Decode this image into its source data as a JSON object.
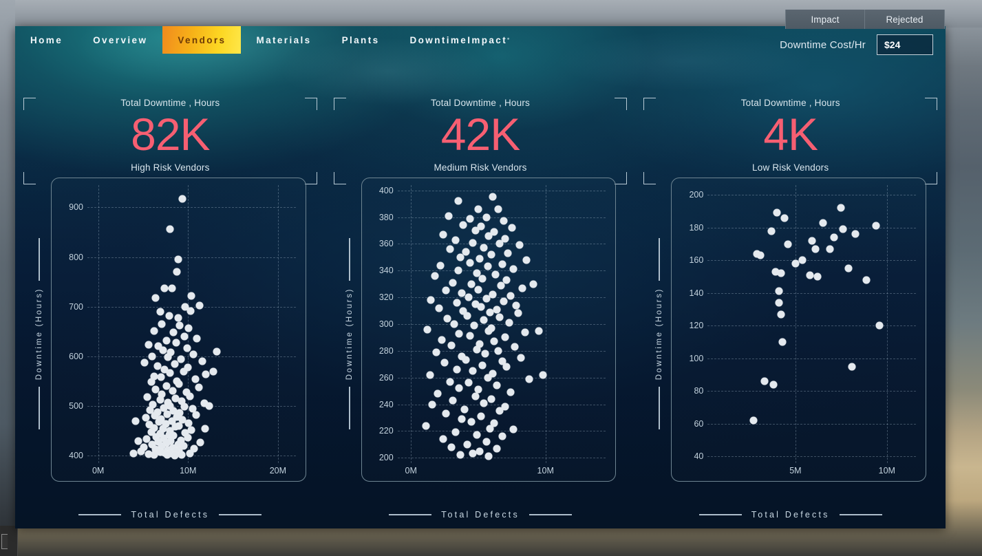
{
  "window": {
    "tabs": [
      {
        "label": "Impact"
      },
      {
        "label": "Rejected"
      }
    ]
  },
  "nav": {
    "items": [
      {
        "label": "Home",
        "active": false
      },
      {
        "label": "Overview",
        "active": false
      },
      {
        "label": "Vendors",
        "active": true
      },
      {
        "label": "Materials",
        "active": false
      },
      {
        "label": "Plants",
        "active": false
      },
      {
        "label": "DowntimeImpact",
        "active": false
      }
    ]
  },
  "cost": {
    "label": "Downtime Cost/Hr",
    "value": "$24",
    "placeholder": "$24"
  },
  "kpis": [
    {
      "top": "Total Downtime , Hours",
      "value": "82K",
      "bottom": "High Risk Vendors"
    },
    {
      "top": "Total Downtime , Hours",
      "value": "42K",
      "bottom": "Medium Risk Vendors"
    },
    {
      "top": "Total Downtime , Hours",
      "value": "4K",
      "bottom": "Low Risk Vendors"
    }
  ],
  "colors": {
    "accent_kpi": "#f65f72",
    "nav_active_start": "#f08a1e",
    "nav_active_end": "#ffe74a",
    "dot": "#e4e9ee",
    "panel_border": "#6e8592"
  },
  "chart_data": [
    {
      "type": "scatter",
      "title": "High Risk Vendors",
      "xlabel": "Total Defects",
      "ylabel": "Downtime (Hours)",
      "xticks": [
        "0M",
        "10M",
        "20M"
      ],
      "xtickvals": [
        0,
        10,
        20
      ],
      "yticks": [
        "400",
        "500",
        "600",
        "700",
        "800",
        "900"
      ],
      "ytickvals": [
        400,
        500,
        600,
        700,
        800,
        900
      ],
      "xlim": [
        -1.2,
        22
      ],
      "ylim": [
        385,
        945
      ],
      "grid": true,
      "legend": "none",
      "points": [
        [
          9.4,
          917
        ],
        [
          8.0,
          856
        ],
        [
          8.9,
          796
        ],
        [
          8.8,
          770
        ],
        [
          7.4,
          737
        ],
        [
          8.2,
          737
        ],
        [
          6.4,
          718
        ],
        [
          11.3,
          702
        ],
        [
          10.4,
          722
        ],
        [
          9.7,
          700
        ],
        [
          10.3,
          692
        ],
        [
          6.9,
          690
        ],
        [
          7.9,
          682
        ],
        [
          8.9,
          677
        ],
        [
          7.1,
          665
        ],
        [
          9.1,
          662
        ],
        [
          10.1,
          657
        ],
        [
          6.2,
          651
        ],
        [
          8.4,
          648
        ],
        [
          9.6,
          640
        ],
        [
          11.0,
          636
        ],
        [
          7.6,
          632
        ],
        [
          8.7,
          628
        ],
        [
          5.6,
          624
        ],
        [
          6.7,
          620
        ],
        [
          9.9,
          616
        ],
        [
          7.2,
          612
        ],
        [
          8.1,
          608
        ],
        [
          10.6,
          604
        ],
        [
          6.0,
          600
        ],
        [
          7.8,
          598
        ],
        [
          9.2,
          594
        ],
        [
          11.6,
          590
        ],
        [
          5.2,
          588
        ],
        [
          8.5,
          584
        ],
        [
          6.6,
          580
        ],
        [
          10.0,
          578
        ],
        [
          7.4,
          574
        ],
        [
          9.5,
          570
        ],
        [
          8.0,
          566
        ],
        [
          12.0,
          564
        ],
        [
          6.2,
          560
        ],
        [
          7.0,
          558
        ],
        [
          10.8,
          554
        ],
        [
          8.8,
          550
        ],
        [
          5.9,
          548
        ],
        [
          9.0,
          544
        ],
        [
          7.6,
          540
        ],
        [
          11.2,
          538
        ],
        [
          6.4,
          534
        ],
        [
          8.3,
          530
        ],
        [
          9.8,
          528
        ],
        [
          7.1,
          524
        ],
        [
          10.2,
          520
        ],
        [
          5.5,
          518
        ],
        [
          8.6,
          515
        ],
        [
          6.9,
          512
        ],
        [
          9.3,
          510
        ],
        [
          7.8,
          507
        ],
        [
          11.8,
          505
        ],
        [
          6.1,
          503
        ],
        [
          8.0,
          500
        ],
        [
          9.6,
          498
        ],
        [
          7.3,
          496
        ],
        [
          10.5,
          494
        ],
        [
          5.8,
          492
        ],
        [
          8.4,
          490
        ],
        [
          6.6,
          488
        ],
        [
          9.1,
          486
        ],
        [
          7.7,
          484
        ],
        [
          10.9,
          482
        ],
        [
          6.3,
          480
        ],
        [
          8.8,
          478
        ],
        [
          5.3,
          476
        ],
        [
          7.0,
          474
        ],
        [
          9.4,
          472
        ],
        [
          8.2,
          470
        ],
        [
          6.8,
          468
        ],
        [
          10.1,
          466
        ],
        [
          7.5,
          464
        ],
        [
          5.7,
          462
        ],
        [
          9.0,
          460
        ],
        [
          8.6,
          458
        ],
        [
          6.2,
          456
        ],
        [
          7.2,
          454
        ],
        [
          10.4,
          452
        ],
        [
          8.0,
          450
        ],
        [
          5.9,
          448
        ],
        [
          9.7,
          446
        ],
        [
          6.9,
          444
        ],
        [
          7.9,
          442
        ],
        [
          8.4,
          440
        ],
        [
          6.5,
          438
        ],
        [
          10.0,
          437
        ],
        [
          7.3,
          435
        ],
        [
          5.4,
          433
        ],
        [
          9.2,
          431
        ],
        [
          8.1,
          429
        ],
        [
          6.7,
          428
        ],
        [
          11.4,
          427
        ],
        [
          7.6,
          425
        ],
        [
          8.9,
          423
        ],
        [
          6.0,
          422
        ],
        [
          9.5,
          420
        ],
        [
          7.1,
          419
        ],
        [
          5.1,
          417
        ],
        [
          8.3,
          416
        ],
        [
          10.7,
          414
        ],
        [
          6.4,
          413
        ],
        [
          7.8,
          411
        ],
        [
          9.0,
          410
        ],
        [
          8.6,
          409
        ],
        [
          4.8,
          408
        ],
        [
          6.9,
          407
        ],
        [
          7.4,
          406
        ],
        [
          10.2,
          405
        ],
        [
          8.0,
          404
        ],
        [
          5.6,
          403
        ],
        [
          9.3,
          402
        ],
        [
          6.2,
          401
        ],
        [
          7.7,
          401
        ],
        [
          8.5,
          400
        ],
        [
          11.9,
          455
        ],
        [
          12.4,
          500
        ],
        [
          12.8,
          570
        ],
        [
          4.5,
          430
        ],
        [
          4.2,
          470
        ],
        [
          13.2,
          610
        ],
        [
          3.9,
          405
        ]
      ]
    },
    {
      "type": "scatter",
      "title": "Medium Risk Vendors",
      "xlabel": "Total Defects",
      "ylabel": "Downtime (Hours)",
      "xticks": [
        "0M",
        "10M"
      ],
      "xtickvals": [
        0,
        10
      ],
      "yticks": [
        "200",
        "220",
        "240",
        "260",
        "280",
        "300",
        "320",
        "340",
        "360",
        "380",
        "400"
      ],
      "ytickvals": [
        200,
        220,
        240,
        260,
        280,
        300,
        320,
        340,
        360,
        380,
        400
      ],
      "xlim": [
        -1.0,
        14.5
      ],
      "ylim": [
        196,
        404
      ],
      "grid": true,
      "legend": "none",
      "points": [
        [
          3.5,
          392
        ],
        [
          6.1,
          395
        ],
        [
          5.0,
          386
        ],
        [
          6.5,
          386
        ],
        [
          2.8,
          381
        ],
        [
          4.4,
          379
        ],
        [
          5.6,
          380
        ],
        [
          6.9,
          377
        ],
        [
          3.9,
          374
        ],
        [
          5.2,
          373
        ],
        [
          7.5,
          372
        ],
        [
          4.8,
          370
        ],
        [
          6.2,
          369
        ],
        [
          2.4,
          367
        ],
        [
          5.8,
          366
        ],
        [
          7.0,
          364
        ],
        [
          3.3,
          363
        ],
        [
          4.6,
          361
        ],
        [
          6.6,
          360
        ],
        [
          8.1,
          359
        ],
        [
          5.4,
          357
        ],
        [
          2.9,
          356
        ],
        [
          4.1,
          354
        ],
        [
          7.2,
          353
        ],
        [
          6.0,
          352
        ],
        [
          3.7,
          350
        ],
        [
          5.1,
          349
        ],
        [
          8.6,
          348
        ],
        [
          4.4,
          346
        ],
        [
          6.8,
          345
        ],
        [
          2.2,
          344
        ],
        [
          5.7,
          343
        ],
        [
          7.6,
          341
        ],
        [
          3.5,
          340
        ],
        [
          4.9,
          338
        ],
        [
          6.3,
          337
        ],
        [
          1.8,
          336
        ],
        [
          5.3,
          334
        ],
        [
          7.1,
          333
        ],
        [
          3.1,
          331
        ],
        [
          4.5,
          330
        ],
        [
          6.7,
          329
        ],
        [
          8.3,
          327
        ],
        [
          5.0,
          326
        ],
        [
          2.6,
          325
        ],
        [
          3.8,
          323
        ],
        [
          6.1,
          322
        ],
        [
          7.4,
          321
        ],
        [
          4.3,
          320
        ],
        [
          5.6,
          319
        ],
        [
          1.5,
          318
        ],
        [
          6.9,
          317
        ],
        [
          3.4,
          316
        ],
        [
          4.8,
          315
        ],
        [
          7.8,
          314
        ],
        [
          5.2,
          313
        ],
        [
          2.1,
          312
        ],
        [
          6.4,
          311
        ],
        [
          3.9,
          310
        ],
        [
          5.9,
          309
        ],
        [
          8.0,
          308
        ],
        [
          4.2,
          306
        ],
        [
          6.6,
          305
        ],
        [
          2.7,
          304
        ],
        [
          5.4,
          303
        ],
        [
          7.3,
          301
        ],
        [
          3.2,
          300
        ],
        [
          4.7,
          299
        ],
        [
          6.0,
          297
        ],
        [
          1.2,
          296
        ],
        [
          5.8,
          295
        ],
        [
          8.5,
          294
        ],
        [
          3.6,
          293
        ],
        [
          4.4,
          291
        ],
        [
          7.0,
          290
        ],
        [
          2.3,
          288
        ],
        [
          6.2,
          287
        ],
        [
          5.1,
          285
        ],
        [
          3.0,
          284
        ],
        [
          7.7,
          283
        ],
        [
          4.9,
          281
        ],
        [
          6.5,
          280
        ],
        [
          1.9,
          279
        ],
        [
          5.5,
          278
        ],
        [
          3.8,
          276
        ],
        [
          8.2,
          275
        ],
        [
          4.1,
          273
        ],
        [
          6.8,
          272
        ],
        [
          2.5,
          271
        ],
        [
          5.3,
          269
        ],
        [
          7.1,
          268
        ],
        [
          3.4,
          266
        ],
        [
          4.6,
          265
        ],
        [
          6.1,
          263
        ],
        [
          1.4,
          262
        ],
        [
          5.7,
          260
        ],
        [
          8.8,
          259
        ],
        [
          2.9,
          257
        ],
        [
          4.3,
          256
        ],
        [
          6.4,
          254
        ],
        [
          3.6,
          252
        ],
        [
          5.0,
          251
        ],
        [
          7.4,
          249
        ],
        [
          2.0,
          248
        ],
        [
          4.8,
          246
        ],
        [
          6.0,
          244
        ],
        [
          3.1,
          243
        ],
        [
          5.4,
          241
        ],
        [
          1.6,
          240
        ],
        [
          7.0,
          238
        ],
        [
          4.0,
          236
        ],
        [
          6.6,
          235
        ],
        [
          2.6,
          233
        ],
        [
          5.2,
          231
        ],
        [
          3.8,
          229
        ],
        [
          4.5,
          227
        ],
        [
          6.2,
          226
        ],
        [
          1.1,
          224
        ],
        [
          5.9,
          222
        ],
        [
          7.6,
          221
        ],
        [
          3.3,
          219
        ],
        [
          4.9,
          217
        ],
        [
          6.8,
          216
        ],
        [
          2.4,
          214
        ],
        [
          5.6,
          212
        ],
        [
          4.2,
          210
        ],
        [
          3.0,
          208
        ],
        [
          6.4,
          207
        ],
        [
          5.1,
          205
        ],
        [
          4.6,
          203
        ],
        [
          3.7,
          202
        ],
        [
          5.8,
          201
        ],
        [
          9.1,
          330
        ],
        [
          9.5,
          295
        ],
        [
          9.8,
          262
        ]
      ]
    },
    {
      "type": "scatter",
      "title": "Low Risk Vendors",
      "xlabel": "Total Defects",
      "ylabel": "Downtime (Hours)",
      "xticks": [
        "5M",
        "10M"
      ],
      "xtickvals": [
        5,
        10
      ],
      "yticks": [
        "40",
        "60",
        "80",
        "100",
        "120",
        "140",
        "160",
        "180",
        "200"
      ],
      "ytickvals": [
        40,
        60,
        80,
        100,
        120,
        140,
        160,
        180,
        200
      ],
      "xlim": [
        0.2,
        11.6
      ],
      "ylim": [
        36,
        206
      ],
      "grid": true,
      "legend": "none",
      "points": [
        [
          4.0,
          189
        ],
        [
          4.4,
          186
        ],
        [
          7.5,
          192
        ],
        [
          6.5,
          183
        ],
        [
          3.7,
          178
        ],
        [
          9.4,
          181
        ],
        [
          5.9,
          172
        ],
        [
          4.6,
          170
        ],
        [
          6.1,
          167
        ],
        [
          6.9,
          167
        ],
        [
          2.9,
          164
        ],
        [
          3.1,
          163
        ],
        [
          5.4,
          160
        ],
        [
          7.6,
          179
        ],
        [
          8.3,
          176
        ],
        [
          7.1,
          174
        ],
        [
          3.9,
          153
        ],
        [
          4.2,
          152
        ],
        [
          5.8,
          151
        ],
        [
          6.2,
          150
        ],
        [
          8.9,
          148
        ],
        [
          4.1,
          141
        ],
        [
          4.1,
          134
        ],
        [
          4.2,
          127
        ],
        [
          9.6,
          120
        ],
        [
          4.3,
          110
        ],
        [
          8.1,
          95
        ],
        [
          3.3,
          86
        ],
        [
          3.8,
          84
        ],
        [
          2.7,
          62
        ],
        [
          5.0,
          158
        ],
        [
          7.9,
          155
        ]
      ]
    }
  ]
}
